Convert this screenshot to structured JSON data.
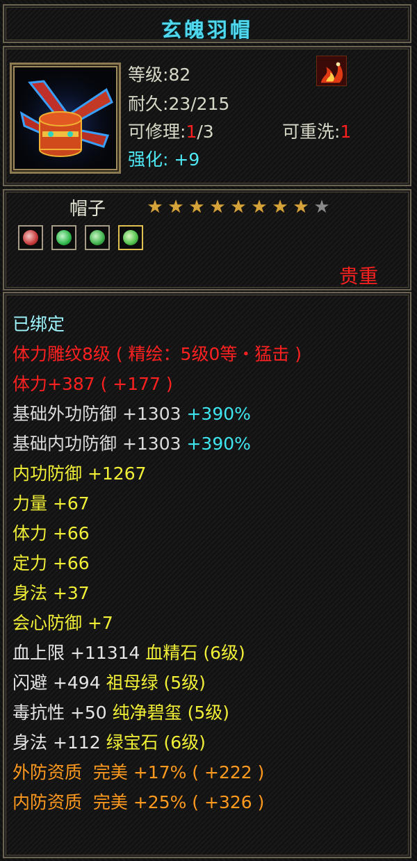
{
  "item": {
    "name": "玄魄羽帽",
    "level_label": "等级",
    "level_value": ":82",
    "durability_label": "耐久",
    "durability_value": ":23/215",
    "repair_label": "可修理",
    "repair_sep": ":",
    "repair_value": "1",
    "repair_max": "/3",
    "reroll_label": "可重洗",
    "reroll_sep": ":",
    "reroll_value": "1",
    "enhance_label": "强化",
    "enhance_sep": ":",
    "enhance_value": "+9",
    "type": "帽子",
    "stars_filled": 8,
    "stars_total": 9,
    "rarity": "贵重",
    "icon": "feather-hat-icon",
    "badge_icon": "flame-icon"
  },
  "gem_slots": [
    {
      "icon": "red-engraved-gem-icon",
      "color": "#c83a3a"
    },
    {
      "icon": "green-gem-icon",
      "color": "#2fb84a"
    },
    {
      "icon": "green-gem-icon",
      "color": "#3cb04a"
    },
    {
      "icon": "green-gem-icon",
      "color": "#4fc04a"
    }
  ],
  "attributes": [
    {
      "text": "已绑定",
      "color": "cyan"
    },
    {
      "text": "体力雕纹8级 ( 精绘：5级0等・猛击 )",
      "color": "red"
    },
    {
      "text": "体力+387 ( +177 )",
      "color": "red"
    },
    {
      "text": "基础外功防御 +1303",
      "extra": "+390%",
      "color": "gray"
    },
    {
      "text": "基础内功防御 +1303",
      "extra": "+390%",
      "color": "gray"
    },
    {
      "text": "内功防御 +1267",
      "color": "yellow"
    },
    {
      "text": "力量 +67",
      "color": "yellow"
    },
    {
      "text": "体力 +66",
      "color": "yellow"
    },
    {
      "text": "定力 +66",
      "color": "yellow"
    },
    {
      "text": "身法 +37",
      "color": "yellow"
    },
    {
      "text": "会心防御 +7",
      "color": "yellow"
    },
    {
      "text": "血上限 +11314",
      "extra": "血精石 (6级)",
      "color": "white-yellow"
    },
    {
      "text": "闪避 +494",
      "extra": "祖母绿 (5级)",
      "color": "white-yellow"
    },
    {
      "text": "毒抗性 +50",
      "extra": "纯净碧玺 (5级)",
      "color": "white-yellow"
    },
    {
      "text": "身法 +112",
      "extra": "绿宝石 (6级)",
      "color": "white-yellow"
    },
    {
      "text": "外防资质  完美 +17% ( +222 )",
      "color": "orange"
    },
    {
      "text": "内防资质  完美 +25% ( +326 )",
      "color": "orange"
    }
  ],
  "colors": {
    "title": "#4fd8ee",
    "rarity": "#ff2020",
    "bound": "#9ff6ff",
    "engrave": "#ff2020",
    "base": "#dcdcdc",
    "percent": "#3fe6f0",
    "stat": "#f2f036",
    "quality": "#ff9a1e"
  }
}
